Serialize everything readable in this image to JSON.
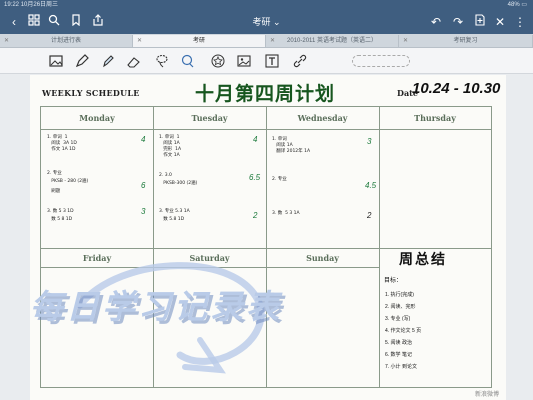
{
  "status": {
    "time": "19:22",
    "date": "10月26日周三",
    "battery": "48%"
  },
  "nav": {
    "title": "考研"
  },
  "tabs": [
    {
      "label": "计划进行表",
      "active": false
    },
    {
      "label": "考研",
      "active": true
    },
    {
      "label": "2010-2011 英语考试题（英语二）",
      "active": false
    },
    {
      "label": "考研复习",
      "active": false
    }
  ],
  "page": {
    "header_label": "WEEKLY SCHEDULE",
    "title": "十月第四周计划",
    "date_label": "Date",
    "date_value": "10.24 - 10.30"
  },
  "days": [
    "Monday",
    "Tuesday",
    "Wednesday",
    "Thursday",
    "Friday",
    "Saturday",
    "Sunday"
  ],
  "notes": {
    "monday": [
      "1. 单词  1",
      "   阅读  3A 1D",
      "   作文 1A 1D",
      "2. 专业",
      "   PKSB - 280 (2遍)",
      "   刷题",
      "3. 数 5 3 1D",
      "   数 5 8 1D"
    ],
    "monday_scores": [
      "4",
      "6",
      "3"
    ],
    "tuesday": [
      "1. 单词  1",
      "   阅读 1A",
      "   完形  1A",
      "   作文 1A",
      "2. 3.0",
      "   PKSB-300 (2遍)",
      "3. 专业 5.3 1A",
      "   数 5.8 1D"
    ],
    "tuesday_scores": [
      "4",
      "6.5",
      "2"
    ],
    "wednesday": [
      "1. 单词",
      "   阅读 1A",
      "   翻译 2012年 1A",
      "2. 专业",
      "3. 数  5 3 1A"
    ],
    "wednesday_scores": [
      "3",
      "4.5",
      "2"
    ]
  },
  "summary": {
    "title": "周总结",
    "heading": "目标：",
    "items": [
      "1. 执行(完成)",
      "2. 阅读、完形",
      "3. 专业 (写)",
      "4. 作文论文 5 页",
      "5. 阅读 政治",
      "6. 数学 笔记",
      "7. 小计 到论文"
    ]
  },
  "overlay_text": "每日学习记录表",
  "watermark": "新浪微博"
}
